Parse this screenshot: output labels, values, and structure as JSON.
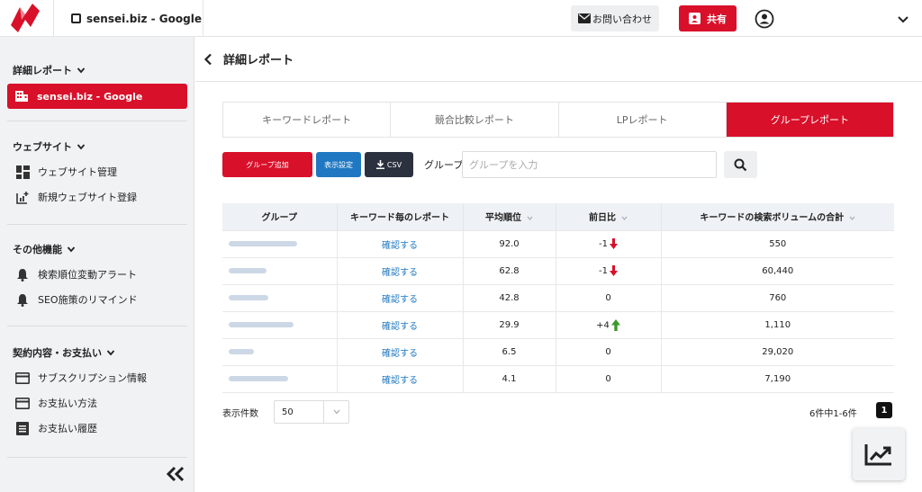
{
  "header": {
    "site_name": "sensei.biz - Google",
    "contact_label": "お問い合わせ",
    "share_label": "共有"
  },
  "sidebar": {
    "sections": [
      {
        "title": "詳細レポート",
        "items": [
          {
            "label": "sensei.biz - Google",
            "icon": "building-icon",
            "active": true
          }
        ]
      },
      {
        "title": "ウェブサイト",
        "items": [
          {
            "label": "ウェブサイト管理",
            "icon": "dashboard-icon"
          },
          {
            "label": "新規ウェブサイト登録",
            "icon": "add-chart-icon"
          }
        ]
      },
      {
        "title": "その他機能",
        "items": [
          {
            "label": "検索順位変動アラート",
            "icon": "bell-icon"
          },
          {
            "label": "SEO施策のリマインド",
            "icon": "bell-icon"
          }
        ]
      },
      {
        "title": "契約内容・お支払い",
        "items": [
          {
            "label": "サブスクリプション情報",
            "icon": "card-icon"
          },
          {
            "label": "お支払い方法",
            "icon": "card-icon"
          },
          {
            "label": "お支払い履歴",
            "icon": "document-icon"
          }
        ]
      }
    ]
  },
  "main": {
    "title": "詳細レポート",
    "tabs": [
      {
        "label": "キーワードレポート",
        "active": false
      },
      {
        "label": "競合比較レポート",
        "active": false
      },
      {
        "label": "LPレポート",
        "active": false
      },
      {
        "label": "グループレポート",
        "active": true
      }
    ],
    "toolbar": {
      "add_group_label": "グループ追加",
      "display_settings_label": "表示設定",
      "csv_label": "CSV",
      "group_label": "グループ",
      "group_placeholder": "グループを入力"
    },
    "table": {
      "headers": [
        "グループ",
        "キーワード毎のレポート",
        "平均順位",
        "前日比",
        "キーワードの検索ボリュームの合計"
      ],
      "rows": [
        {
          "link": "確認する",
          "avg_rank": "92.0",
          "change": "-1",
          "direction": "down",
          "volume": "550"
        },
        {
          "link": "確認する",
          "avg_rank": "62.8",
          "change": "-1",
          "direction": "down",
          "volume": "60,440"
        },
        {
          "link": "確認する",
          "avg_rank": "42.8",
          "change": "0",
          "direction": "none",
          "volume": "760"
        },
        {
          "link": "確認する",
          "avg_rank": "29.9",
          "change": "+4",
          "direction": "up",
          "volume": "1,110"
        },
        {
          "link": "確認する",
          "avg_rank": "6.5",
          "change": "0",
          "direction": "none",
          "volume": "29,020"
        },
        {
          "link": "確認する",
          "avg_rank": "4.1",
          "change": "0",
          "direction": "none",
          "volume": "7,190"
        }
      ]
    },
    "pagination": {
      "per_page_label": "表示件数",
      "per_page_value": "50",
      "count_text": "6件中1-6件",
      "current_page": "1"
    }
  },
  "colors": {
    "brand_red": "#d9102a",
    "blue": "#1f78c1",
    "dark": "#2c3140",
    "up_green": "#3a9a2a"
  }
}
